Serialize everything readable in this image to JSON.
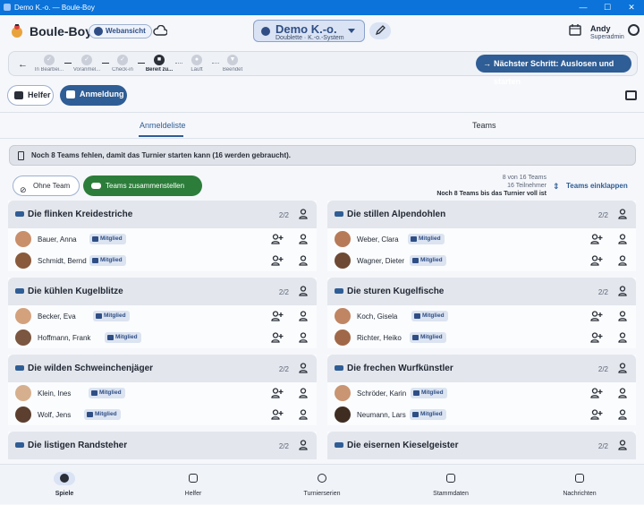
{
  "window": {
    "title": "Demo K.-o. — Boule-Boy",
    "min": "—",
    "max": "☐",
    "close": "✕"
  },
  "app": {
    "title": "Boule-Boy",
    "web_button": "Webansicht"
  },
  "tournament": {
    "name": "Demo K.-o.",
    "subtitle": "Doublette · K.-o.-System"
  },
  "user": {
    "name": "Andy",
    "role": "Superadmin"
  },
  "stepper": {
    "steps": [
      {
        "label": "In Bearbei...",
        "icon": "check-icon"
      },
      {
        "label": "Voranmel...",
        "icon": "check-icon"
      },
      {
        "label": "Check-in",
        "icon": "check-icon"
      },
      {
        "label": "Bereit zu...",
        "icon": "stop-icon"
      },
      {
        "label": "Läuft",
        "icon": "play-icon"
      },
      {
        "label": "Beendet",
        "icon": "trophy-icon"
      }
    ],
    "next_button": "Nächster Schritt: Auslosen und starten"
  },
  "pills": {
    "helfer": "Helfer",
    "anmeldung": "Anmeldung"
  },
  "subtabs": {
    "anmeldeliste": "Anmeldeliste",
    "teams": "Teams"
  },
  "alert": "Noch 8 Teams fehlen, damit das Turnier starten kann (16 werden gebraucht).",
  "actions": {
    "ohne_team": "Ohne Team",
    "zusammenstellen": "Teams zusammenstellen",
    "collapse": "Teams einklappen"
  },
  "stats": {
    "teams": "8 von 16 Teams",
    "participants": "16 Teilnehmer",
    "remaining": "Noch 8 Teams bis das Turnier voll ist"
  },
  "badge_label": "Mitglied",
  "teams": [
    {
      "name": "Die flinken Kreidestriche",
      "count": "2/2",
      "players": [
        "Bauer, Anna",
        "Schmidt, Bernd"
      ]
    },
    {
      "name": "Die stillen Alpendohlen",
      "count": "2/2",
      "players": [
        "Weber, Clara",
        "Wagner, Dieter"
      ]
    },
    {
      "name": "Die kühlen Kugelblitze",
      "count": "2/2",
      "players": [
        "Becker, Eva",
        "Hoffmann, Frank"
      ]
    },
    {
      "name": "Die sturen Kugelfische",
      "count": "2/2",
      "players": [
        "Koch, Gisela",
        "Richter, Heiko"
      ]
    },
    {
      "name": "Die wilden Schweinchenjäger",
      "count": "2/2",
      "players": [
        "Klein, Ines",
        "Wolf, Jens"
      ]
    },
    {
      "name": "Die frechen Wurfkünstler",
      "count": "2/2",
      "players": [
        "Schröder, Karin",
        "Neumann, Lars"
      ]
    },
    {
      "name": "Die listigen Randsteher",
      "count": "2/2",
      "players": []
    },
    {
      "name": "Die eisernen Kieselgeister",
      "count": "2/2",
      "players": []
    }
  ],
  "bottom_nav": [
    "Spiele",
    "Helfer",
    "Turnierserien",
    "Stammdaten",
    "Nachrichten"
  ],
  "colors": {
    "primary": "#2f5d95",
    "green": "#2c7d3a",
    "titlebar": "#0b73d9"
  }
}
